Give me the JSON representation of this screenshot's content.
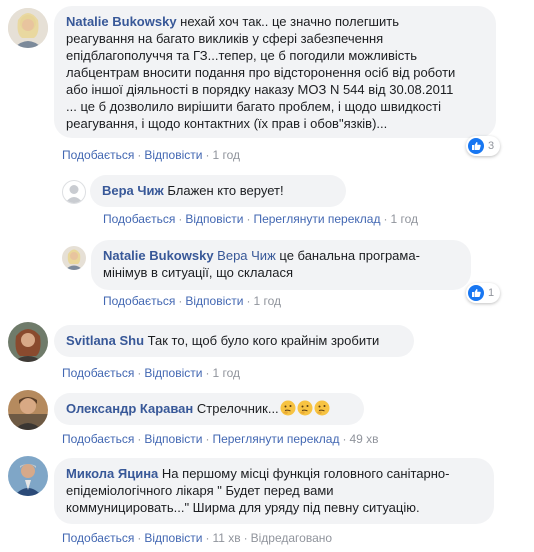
{
  "colors": {
    "author": "#385898",
    "link": "#4267b2",
    "bubble": "#f2f3f5",
    "like": "#1877f2",
    "meta": "#90949c"
  },
  "comments": [
    {
      "author": "Natalie Bukowsky",
      "text": "нехай хоч так.. це значно полегшить\nреагування на багато викликів у сфері забезпечення\nепідблагополуччя та ГЗ...тепер, це б погодили можливість\nлабцентрам вносити подання про відсторонення осіб від роботи\nабо іншої діяльності в порядку наказу МОЗ N 544 від 30.08.2011\n... це б дозволило вирішити багато проблем, і щодо швидкості\nреагування, і щодо контактних (їх прав і обов\"язків)...",
      "like": "Подобається",
      "reply": "Відповісти",
      "time": "1 год",
      "reactions": "3",
      "reaction_icon": "like-icon"
    },
    {
      "author": "Вера Чиж",
      "text": "Блажен кто верует!",
      "like": "Подобається",
      "reply": "Відповісти",
      "translate": "Переглянути переклад",
      "time": "1 год"
    },
    {
      "author": "Natalie Bukowsky",
      "mention": "Вера Чиж",
      "text": "це банальна програма-\nмінімув в ситуації, що склалася",
      "like": "Подобається",
      "reply": "Відповісти",
      "time": "1 год",
      "reactions": "1",
      "reaction_icon": "like-icon"
    },
    {
      "author": "Svitlana Shu",
      "text": "Так то, щоб було кого крайнім зробити",
      "like": "Подобається",
      "reply": "Відповісти",
      "time": "1 год"
    },
    {
      "author": "Олександр Караван",
      "text": "Стрелочник...",
      "emojis": [
        "thinking-face-icon",
        "thinking-face-icon",
        "thinking-face-icon"
      ],
      "like": "Подобається",
      "reply": "Відповісти",
      "translate": "Переглянути переклад",
      "time": "49 хв"
    },
    {
      "author": "Микола Яцина",
      "text": "На першому місці функція головного санітарно-\nепідеміологічного лікаря \" Будет перед вами\nкоммуницировать...\" Ширма для уряду під певну ситуацію.",
      "like": "Подобається",
      "reply": "Відповісти",
      "time": "11 хв",
      "edited": "Відредаговано"
    }
  ]
}
